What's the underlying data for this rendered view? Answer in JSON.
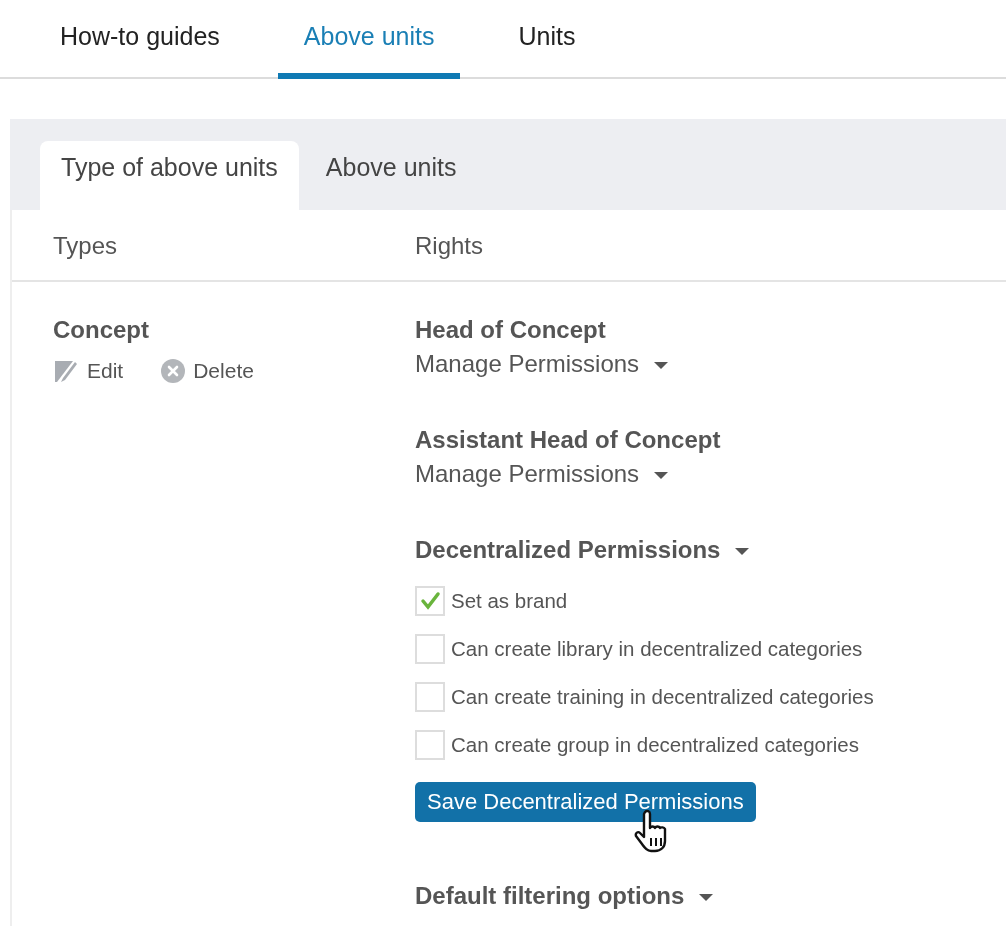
{
  "top_tabs": [
    {
      "label": "How-to guides",
      "selected": false
    },
    {
      "label": "Above units",
      "selected": true
    },
    {
      "label": "Units",
      "selected": false
    }
  ],
  "sub_tabs": [
    {
      "label": "Type of above units",
      "selected": true
    },
    {
      "label": "Above units",
      "selected": false
    }
  ],
  "table": {
    "columns": [
      "Types",
      "Rights"
    ],
    "rows": [
      {
        "type": "Concept",
        "actions": [
          {
            "kind": "edit",
            "label": "Edit"
          },
          {
            "kind": "delete",
            "label": "Delete"
          }
        ],
        "rights": [
          {
            "kind": "role",
            "title": "Head of Concept",
            "menu": "Manage Permissions"
          },
          {
            "kind": "role",
            "title": "Assistant Head of Concept",
            "menu": "Manage Permissions"
          },
          {
            "kind": "dropdown",
            "title": "Decentralized Permissions",
            "checkboxes": [
              {
                "label": "Set as brand",
                "checked": true
              },
              {
                "label": "Can create library in decentralized categories",
                "checked": false
              },
              {
                "label": "Can create training in decentralized categories",
                "checked": false
              },
              {
                "label": "Can create group in decentralized categories",
                "checked": false
              }
            ],
            "button": "Save Decentralized Permissions"
          },
          {
            "kind": "dropdown",
            "title": "Default filtering options"
          }
        ]
      }
    ]
  }
}
